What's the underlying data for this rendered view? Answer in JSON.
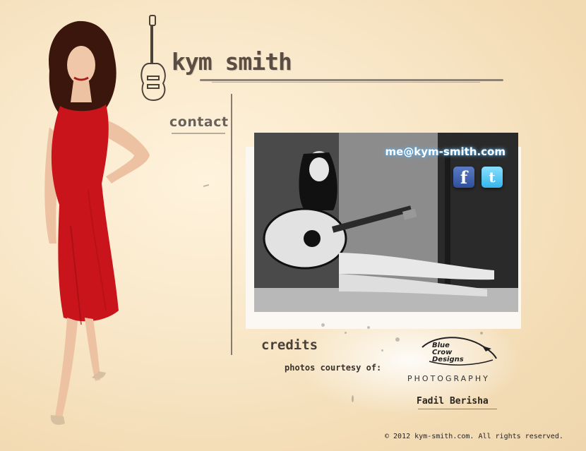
{
  "site": {
    "title": "kym smith"
  },
  "nav": {
    "contact_label": "contact"
  },
  "contact": {
    "email": "me@kym-smith.com",
    "social": [
      {
        "name": "facebook",
        "glyph": "f"
      },
      {
        "name": "twitter",
        "glyph": "t"
      }
    ]
  },
  "credits": {
    "title": "credits",
    "courtesy_label": "photos courtesy of:",
    "studio_name_line1": "Blue",
    "studio_name_line2": "Crow",
    "studio_name_line3": "Designs",
    "studio_tagline": "PHOTOGRAPHY",
    "photographer": "Fadil Berisha"
  },
  "footer": {
    "copyright": "© 2012 kym-smith.com. All rights reserved."
  },
  "colors": {
    "accent_red": "#c8141a",
    "text_brown": "#5a4e44",
    "email_glow": "#6fc4ff"
  }
}
